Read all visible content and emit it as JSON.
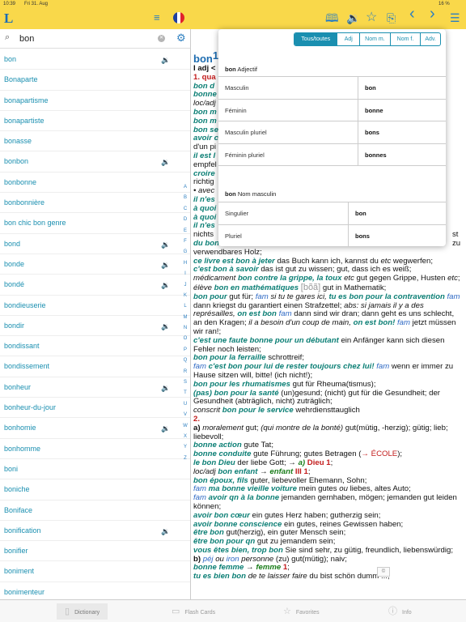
{
  "status": {
    "time": "10:39",
    "date": "Fri 31. Aug",
    "battery": "16 %"
  },
  "app": {
    "logo": "L"
  },
  "toolbar": {
    "icons": [
      "book-icon",
      "speaker-icon",
      "star-icon",
      "add-folder-icon",
      "chevron-left-icon",
      "chevron-right-icon",
      "menu-icon"
    ],
    "glyphs": {
      "book": "🕮",
      "speaker": "🔉",
      "star": "☆",
      "add_folder": "⎘",
      "back": "‹",
      "forward": "›",
      "menu": "☰",
      "list": "≡"
    }
  },
  "search": {
    "value": "bon",
    "placeholder": ""
  },
  "results": [
    {
      "word": "bon",
      "audio": true
    },
    {
      "word": "Bonaparte",
      "audio": false
    },
    {
      "word": "bonapartisme",
      "audio": false
    },
    {
      "word": "bonapartiste",
      "audio": false
    },
    {
      "word": "bonasse",
      "audio": false
    },
    {
      "word": "bonbon",
      "audio": true
    },
    {
      "word": "bonbonne",
      "audio": false
    },
    {
      "word": "bonbonnière",
      "audio": false
    },
    {
      "word": "bon chic bon genre",
      "audio": false
    },
    {
      "word": "bond",
      "audio": true
    },
    {
      "word": "bonde",
      "audio": true
    },
    {
      "word": "bondé",
      "audio": true
    },
    {
      "word": "bondieuserie",
      "audio": false
    },
    {
      "word": "bondir",
      "audio": true
    },
    {
      "word": "bondissant",
      "audio": false
    },
    {
      "word": "bondissement",
      "audio": false
    },
    {
      "word": "bonheur",
      "audio": true
    },
    {
      "word": "bonheur-du-jour",
      "audio": false
    },
    {
      "word": "bonhomie",
      "audio": true
    },
    {
      "word": "bonhomme",
      "audio": false
    },
    {
      "word": "boni",
      "audio": false
    },
    {
      "word": "boniche",
      "audio": false
    },
    {
      "word": "Boniface",
      "audio": false
    },
    {
      "word": "bonification",
      "audio": true
    },
    {
      "word": "bonifier",
      "audio": false
    },
    {
      "word": "boniment",
      "audio": false
    },
    {
      "word": "bonimenteur",
      "audio": false
    }
  ],
  "alphabet": [
    "A",
    "B",
    "C",
    "D",
    "E",
    "F",
    "G",
    "H",
    "I",
    "J",
    "K",
    "L",
    "M",
    "N",
    "O",
    "P",
    "Q",
    "R",
    "S",
    "T",
    "U",
    "V",
    "W",
    "X",
    "Y",
    "Z"
  ],
  "popover": {
    "tabs": [
      {
        "label": "Tous/toutes",
        "active": true
      },
      {
        "label": "Adj",
        "active": false
      },
      {
        "label": "Nom m.",
        "active": false
      },
      {
        "label": "Nom f.",
        "active": false
      },
      {
        "label": "Adv.",
        "active": false
      }
    ],
    "adj_word": "bon",
    "adj_pos": "Adjectif",
    "adj_forms": [
      {
        "label": "Masculin",
        "value": "bon"
      },
      {
        "label": "Féminin",
        "value": "bonne"
      },
      {
        "label": "Masculin pluriel",
        "value": "bons"
      },
      {
        "label": "Féminin pluriel",
        "value": "bonnes"
      }
    ],
    "noun_word": "bon",
    "noun_pos": "Nom masculin",
    "noun_forms": [
      {
        "label": "Singulier",
        "value": "bon"
      },
      {
        "label": "Pluriel",
        "value": "bons"
      }
    ]
  },
  "article": {
    "headword": "bon",
    "sup": "1",
    "frag_l1": "I adj <",
    "frag_l2": "1. qua",
    "frag_l3": "bon d",
    "frag_l4": "bonne",
    "frag_l5": "loc/adj",
    "frag_l6": "bon m",
    "frag_l7": "bon m",
    "frag_l8": "bon se",
    "frag_l9": "avoir c",
    "frag_l10": "d'un pi",
    "frag_l11": "il est l",
    "frag_l12": "empfel",
    "frag_l13": "croire",
    "frag_l14": "richtig",
    "frag_l15": "• avec",
    "frag_l16": "il n'es",
    "frag_l17": "à quoi",
    "frag_l18": "à quoi",
    "frag_l19": "il n'es",
    "frag_l20": "nichts",
    "frag_l21": "du bon",
    "frag_r20": "st zu"
  },
  "tabs": [
    {
      "label": "Dictionary",
      "icon": "book-icon",
      "active": true
    },
    {
      "label": "Flash Cards",
      "icon": "cards-icon",
      "active": false
    },
    {
      "label": "Favorites",
      "icon": "star-icon",
      "active": false
    },
    {
      "label": "Info",
      "icon": "info-icon",
      "active": false
    }
  ],
  "colors": {
    "header": "#f9d84a",
    "accent": "#1a8fb0",
    "link": "#2d7fc0"
  }
}
